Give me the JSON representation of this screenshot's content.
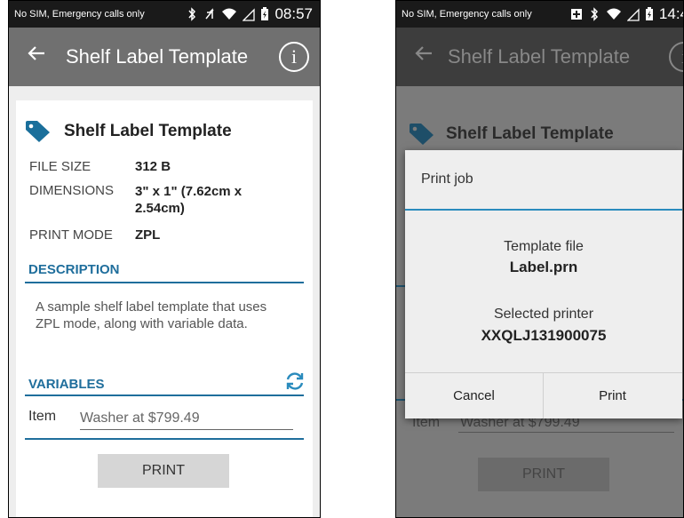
{
  "screen1": {
    "status": {
      "carrier": "No SIM, Emergency calls only",
      "time": "08:57"
    },
    "toolbar": {
      "title": "Shelf Label Template"
    },
    "template": {
      "name": "Shelf Label Template",
      "props": [
        {
          "label": "FILE SIZE",
          "value": "312 B"
        },
        {
          "label": "DIMENSIONS",
          "value": "3\" x 1\" (7.62cm x 2.54cm)"
        },
        {
          "label": "PRINT MODE",
          "value": "ZPL"
        }
      ]
    },
    "description": {
      "title": "DESCRIPTION",
      "text": "A sample shelf label template that uses ZPL mode, along with variable data."
    },
    "variables": {
      "title": "VARIABLES",
      "items": [
        {
          "label": "Item",
          "value": "Washer at $799.49"
        }
      ]
    },
    "print_label": "PRINT"
  },
  "screen2": {
    "status": {
      "carrier": "No SIM, Emergency calls only",
      "time": "14:4"
    },
    "toolbar": {
      "title": "Shelf Label Template"
    },
    "template_name": "Shelf Label Template",
    "bg_item_label": "Item",
    "bg_item_value": "Washer at $799.49",
    "print_label": "PRINT",
    "dialog": {
      "title": "Print job",
      "template_label": "Template file",
      "template_value": "Label.prn",
      "printer_label": "Selected printer",
      "printer_value": "XXQLJ131900075",
      "cancel": "Cancel",
      "print": "Print"
    }
  },
  "colors": {
    "accent": "#1f6e9c",
    "toolbar": "#707070",
    "tag": "#1a6f9b"
  },
  "icons": [
    "back-arrow-icon",
    "info-icon",
    "tag-icon",
    "refresh-icon",
    "bluetooth-icon",
    "wifi-icon",
    "signal-icon",
    "battery-icon"
  ]
}
